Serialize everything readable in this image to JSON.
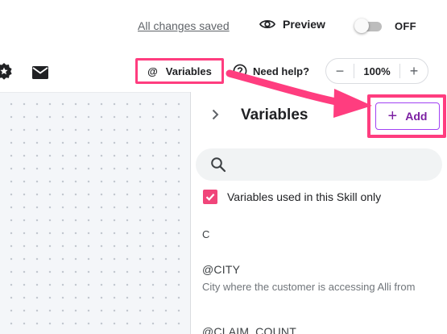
{
  "header": {
    "save_status": "All changes saved",
    "preview_label": "Preview",
    "toggle_state": "OFF"
  },
  "toolbar": {
    "variables_label": "Variables",
    "variables_glyph": "@",
    "help_label": "Need help?",
    "zoom_minus": "−",
    "zoom_value": "100%",
    "zoom_plus": "+"
  },
  "panel": {
    "title": "Variables",
    "add_label": "Add",
    "add_glyph": "+",
    "search_placeholder": "",
    "filter_label": "Variables used in this Skill only",
    "filter_checked": true,
    "section_letter": "C",
    "variables": [
      {
        "name": "@CITY",
        "description": "City where the customer is accessing Alli from"
      },
      {
        "name": "@CLAIM_COUNT",
        "description": ""
      }
    ]
  },
  "colors": {
    "highlight": "#ff3d7f",
    "accent_purple": "#7b1fa2",
    "checkbox": "#f0457a"
  },
  "icons": [
    "eye-icon",
    "badge-icon",
    "mail-icon",
    "help-circle-icon",
    "chevron-right-icon",
    "search-icon",
    "check-icon"
  ]
}
